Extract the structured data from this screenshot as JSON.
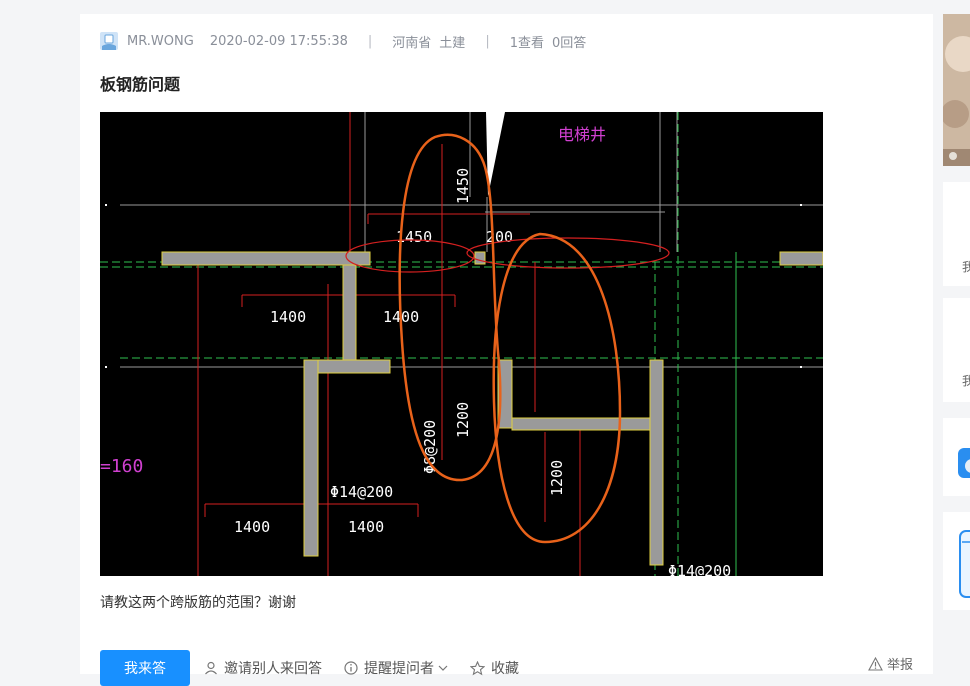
{
  "post": {
    "author": "MR.WONG",
    "timestamp": "2020-02-09 17:55:38",
    "separator": "|",
    "province": "河南省",
    "category": "土建",
    "views": "1查看",
    "answers": "0回答",
    "title": "板钢筋问题",
    "description": "请教这两个跨版筋的范围？谢谢"
  },
  "drawing": {
    "labels": {
      "elevator": "电梯井",
      "dim_1450_v": "1450",
      "dim_1450_h": "1450",
      "dim_200": "200",
      "dim_1400_a": "1400",
      "dim_1400_b": "1400",
      "dim_1400_c": "1400",
      "dim_1400_d": "1400",
      "dim_1200_a": "1200",
      "dim_1200_b": "1200",
      "rebar_phi14_a": "Φ14@200",
      "rebar_phi8": "Φ8@200",
      "rebar_phi14_b": "Φ14@200",
      "thickness": "=160"
    }
  },
  "actions": {
    "answer_button": "我来答",
    "invite": "邀请别人来回答",
    "remind": "提醒提问者",
    "favorite": "收藏",
    "report": "举报"
  },
  "sidebar": {
    "snippet_1": "我",
    "snippet_2": "我"
  },
  "colors": {
    "accent": "#1890ff",
    "annotation": "#e8621a"
  }
}
